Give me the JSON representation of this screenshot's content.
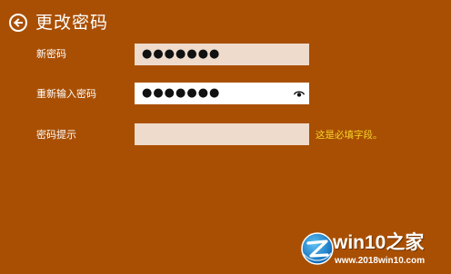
{
  "header": {
    "title": "更改密码"
  },
  "form": {
    "new_password": {
      "label": "新密码",
      "value": "●●●●●●●"
    },
    "confirm_password": {
      "label": "重新输入密码",
      "value": "●●●●●●●"
    },
    "password_hint": {
      "label": "密码提示",
      "value": "",
      "error": "这是必填字段。"
    }
  },
  "watermark": {
    "title": "win10之家",
    "url": "www.2018win10.com"
  },
  "colors": {
    "background": "#a94f03",
    "field_light": "#efdbcc",
    "field_white": "#ffffff",
    "error_text": "#f7d629"
  }
}
